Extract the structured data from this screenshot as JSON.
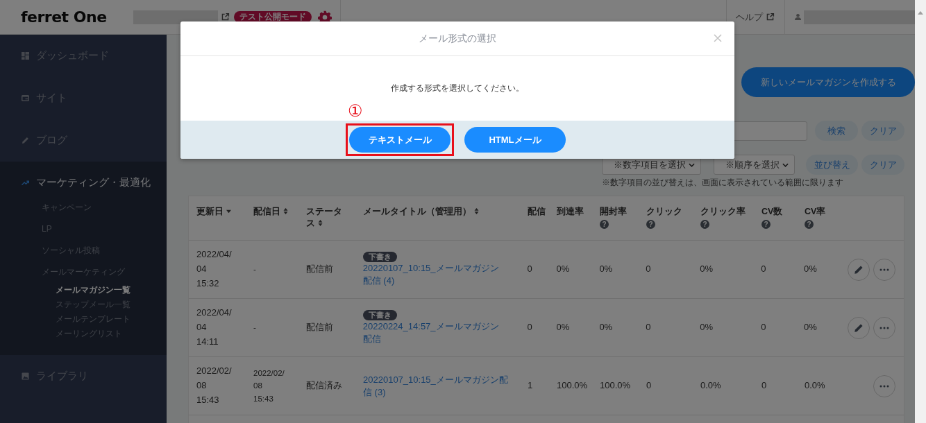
{
  "header": {
    "logo": "ferret One",
    "mode_badge": "テスト公開モード",
    "help_link": "ヘルプ"
  },
  "sidebar": {
    "items": [
      {
        "label": "ダッシュボード",
        "kind": "dashboard",
        "selected": false
      },
      {
        "label": "サイト",
        "kind": "site",
        "selected": false
      },
      {
        "label": "ブログ",
        "kind": "blog",
        "selected": false
      },
      {
        "label": "マーケティング・最適化",
        "kind": "marketing",
        "selected": true,
        "children": [
          {
            "label": "キャンペーン",
            "selected": false
          },
          {
            "label": "LP",
            "selected": false
          },
          {
            "label": "ソーシャル投稿",
            "selected": false
          },
          {
            "label": "メールマーケティング",
            "selected": false,
            "children": [
              {
                "label": "メールマガジン一覧",
                "selected": true
              },
              {
                "label": "ステップメール一覧",
                "selected": false
              },
              {
                "label": "メールテンプレート",
                "selected": false
              },
              {
                "label": "メーリングリスト",
                "selected": false
              }
            ]
          }
        ]
      },
      {
        "label": "ライブラリ",
        "kind": "library",
        "selected": false
      }
    ]
  },
  "toolbar": {
    "new_button": "新しいメールマガジンを作成する",
    "search_button": "検索",
    "search_clear_button": "クリア",
    "sort_field_select": "※数字項目を選択",
    "sort_order_select": "※順序を選択",
    "sort_button": "並び替え",
    "sort_clear_button": "クリア",
    "sort_note": "※数字項目の並び替えは、画面に表示されている範囲に限ります"
  },
  "table": {
    "columns": [
      {
        "label": "更新日",
        "sortable": true,
        "sorted_desc": true
      },
      {
        "label": "配信日",
        "sortable": true,
        "sorted_desc": false
      },
      {
        "label": "ステータス",
        "sortable": true,
        "sorted_desc": false
      },
      {
        "label": "メールタイトル（管理用）",
        "sortable": true,
        "sorted_desc": false
      },
      {
        "label": "配信",
        "sortable": false
      },
      {
        "label": "到達率",
        "sortable": false
      },
      {
        "label": "開封率",
        "sortable": false,
        "help": "?"
      },
      {
        "label": "クリック",
        "sortable": false,
        "help": "?"
      },
      {
        "label": "クリック率",
        "sortable": false,
        "help": "?"
      },
      {
        "label": "CV数",
        "sortable": false,
        "help": "?"
      },
      {
        "label": "CV率",
        "sortable": false,
        "help": "?"
      }
    ],
    "rows": [
      {
        "updated_date": "2022/04/04",
        "updated_time": "15:32",
        "sent_date": "-",
        "status": "配信前",
        "badge": "下書き",
        "title": "20220107_10:15_メールマガジン配信 (4)",
        "delivered": "0",
        "reach": "0%",
        "open": "0%",
        "clicks": "0",
        "click_rate": "0%",
        "cv": "0",
        "cv_rate": "0%",
        "editable": true
      },
      {
        "updated_date": "2022/04/04",
        "updated_time": "14:11",
        "sent_date": "-",
        "status": "配信前",
        "badge": "下書き",
        "title": "20220224_14:57_メールマガジン配信",
        "delivered": "0",
        "reach": "0%",
        "open": "0%",
        "clicks": "0",
        "click_rate": "0%",
        "cv": "0",
        "cv_rate": "0%",
        "editable": true
      },
      {
        "updated_date": "2022/02/08",
        "updated_time": "15:43",
        "sent_date": "2022/02/08",
        "sent_time": "15:43",
        "status": "配信済み",
        "title": "20220107_10:15_メールマガジン配信 (3)",
        "delivered": "1",
        "reach": "100.0%",
        "open": "100.0%",
        "clicks": "0",
        "click_rate": "0.0%",
        "cv": "0",
        "cv_rate": "0.0%",
        "editable": false
      }
    ]
  },
  "modal": {
    "title": "メール形式の選択",
    "message": "作成する形式を選択してください。",
    "buttons": [
      {
        "label": "テキストメール",
        "highlighted": true
      },
      {
        "label": "HTMLメール",
        "highlighted": false
      }
    ],
    "annotation": "①"
  }
}
